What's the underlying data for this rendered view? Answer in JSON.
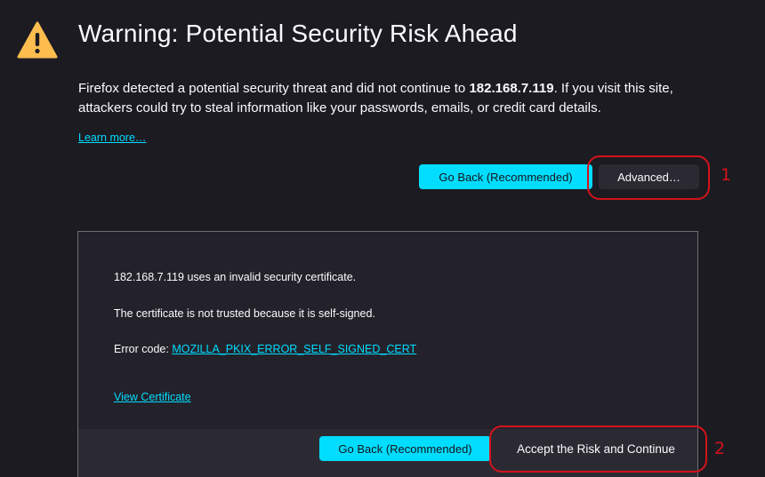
{
  "header": {
    "title": "Warning: Potential Security Risk Ahead",
    "icon": "warning-icon",
    "icon_color": "#ffbd4f"
  },
  "description": {
    "before": "Firefox detected a potential security threat and did not continue to ",
    "host": "182.168.7.119",
    "after": ". If you visit this site, attackers could try to steal information like your passwords, emails, or credit card details."
  },
  "learn_more": "Learn more…",
  "buttons": {
    "go_back": "Go Back (Recommended)",
    "advanced": "Advanced…",
    "accept": "Accept the Risk and Continue"
  },
  "advanced_panel": {
    "invalid_cert": "182.168.7.119 uses an invalid security certificate.",
    "not_trusted": "The certificate is not trusted because it is self-signed.",
    "error_code_label": "Error code: ",
    "error_code": "MOZILLA_PKIX_ERROR_SELF_SIGNED_CERT",
    "view_certificate": "View Certificate"
  },
  "annotations": {
    "step_1": "1",
    "step_2": "2",
    "color": "#d4131b"
  },
  "colors": {
    "background": "#1c1b22",
    "accent": "#00ddff"
  }
}
